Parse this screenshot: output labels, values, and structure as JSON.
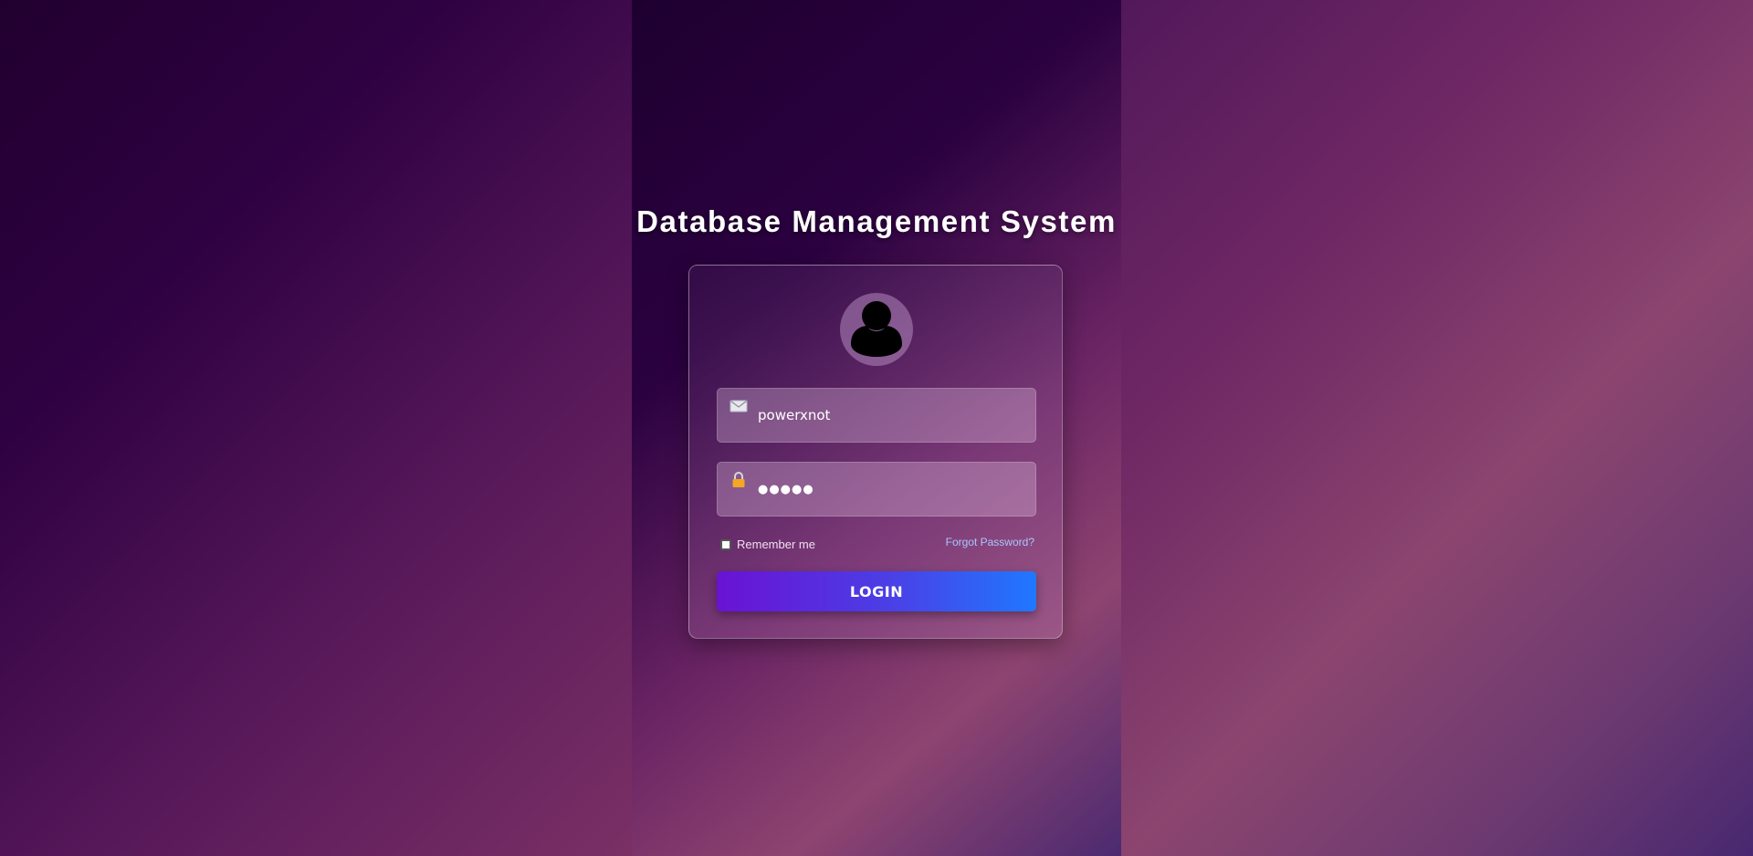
{
  "page": {
    "title": "Database Management System"
  },
  "login_form": {
    "avatar_icon": "user-silhouette-icon",
    "username": {
      "icon": "envelope-icon",
      "value": "powerxnot",
      "placeholder": ""
    },
    "password": {
      "icon": "lock-icon",
      "value": "●●●●●",
      "placeholder": ""
    },
    "remember_label": "Remember me",
    "remember_checked": false,
    "forgot_label": "Forgot Password?",
    "login_label": "LOGIN"
  },
  "colors": {
    "button_gradient_start": "#6a12d4",
    "button_gradient_end": "#1f78ff",
    "link": "#a9c6ff",
    "lock_accent": "#f5a623"
  }
}
